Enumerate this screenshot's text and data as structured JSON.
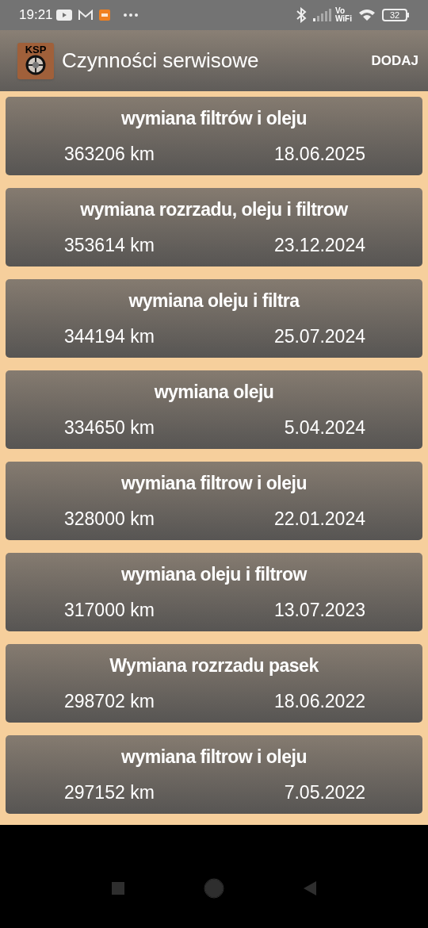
{
  "status_bar": {
    "time": "19:21",
    "vowifi_top": "Vo",
    "vowifi_bottom": "WiFi",
    "battery": "32"
  },
  "app_bar": {
    "logo_text": "KSP",
    "title": "Czynności serwisowe",
    "action": "DODAJ"
  },
  "services": [
    {
      "title": "wymiana filtrów i oleju",
      "mileage": "363206 km",
      "date": "18.06.2025"
    },
    {
      "title": "wymiana rozrzadu, oleju i filtrow",
      "mileage": "353614 km",
      "date": "23.12.2024"
    },
    {
      "title": "wymiana oleju i filtra",
      "mileage": "344194 km",
      "date": "25.07.2024"
    },
    {
      "title": "wymiana oleju",
      "mileage": "334650 km",
      "date": "5.04.2024"
    },
    {
      "title": "wymiana filtrow i oleju",
      "mileage": "328000 km",
      "date": "22.01.2024"
    },
    {
      "title": "wymiana oleju i filtrow",
      "mileage": "317000 km",
      "date": "13.07.2023"
    },
    {
      "title": "Wymiana rozrzadu pasek",
      "mileage": "298702 km",
      "date": "18.06.2022"
    },
    {
      "title": "wymiana filtrow i oleju",
      "mileage": "297152 km",
      "date": "7.05.2022"
    }
  ]
}
